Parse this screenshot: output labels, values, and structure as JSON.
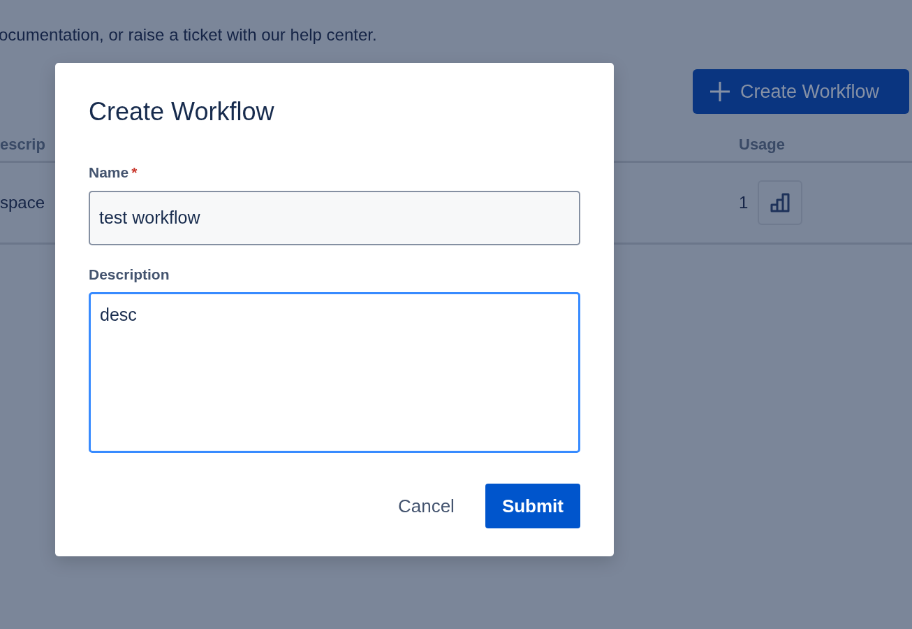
{
  "background": {
    "intro": "ocumentation, or raise a ticket with our help center.",
    "create_button": "Create Workflow",
    "table": {
      "columns": [
        "escrip",
        "Usage"
      ],
      "rows": [
        {
          "description": "space",
          "usage": "1"
        }
      ]
    }
  },
  "dialog": {
    "title": "Create Workflow",
    "fields": [
      {
        "kind": "input",
        "label": "Name",
        "required": true,
        "required_mark": "*",
        "value": "test workflow",
        "focused": false
      },
      {
        "kind": "textarea",
        "label": "Description",
        "required": false,
        "value": "desc",
        "focused": true
      }
    ],
    "buttons": [
      {
        "label": "Cancel",
        "kind": "subtle"
      },
      {
        "label": "Submit",
        "kind": "primary"
      }
    ]
  }
}
